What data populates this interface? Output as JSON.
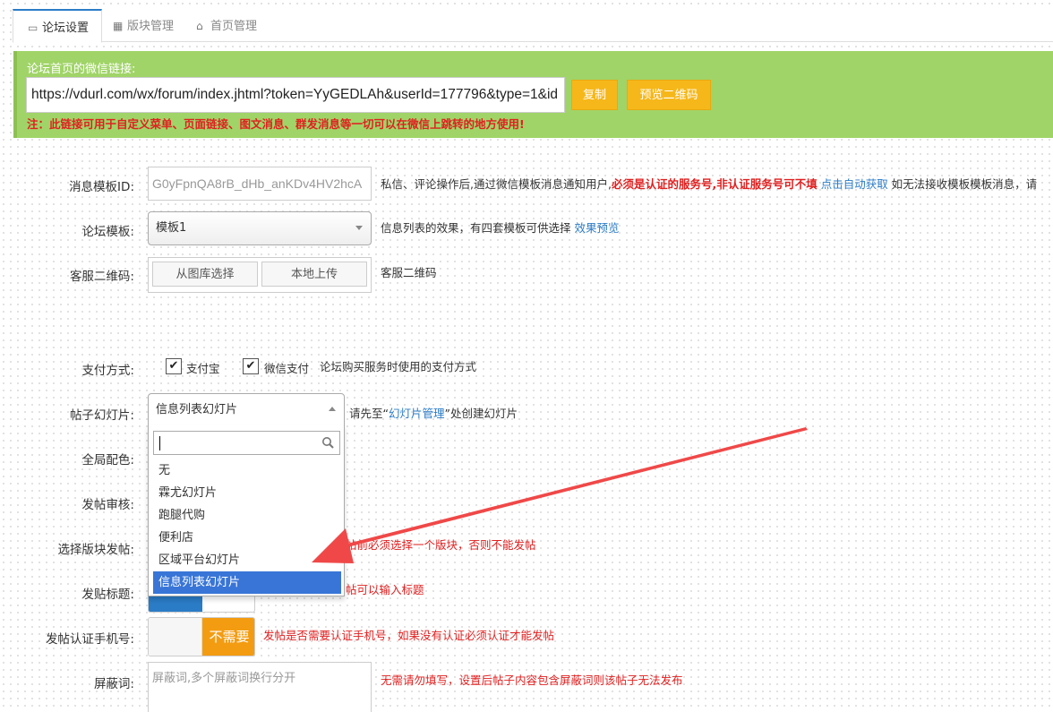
{
  "tabs": [
    {
      "label": "论坛设置",
      "icon": "card-icon",
      "glyph": "▭"
    },
    {
      "label": "版块管理",
      "icon": "grid-icon",
      "glyph": "▦"
    },
    {
      "label": "首页管理",
      "icon": "home-icon",
      "glyph": "⌂"
    }
  ],
  "banner": {
    "title": "论坛首页的微信链接:",
    "url": "https://vdurl.com/wx/forum/index.jhtml?token=YyGEDLAh&userId=177796&type=1&id",
    "copy_label": "复制",
    "preview_label": "预览二维码",
    "note": "注：此链接可用于自定义菜单、页面链接、图文消息、群发消息等一切可以在微信上跳转的地方使用!"
  },
  "form": {
    "msg_template": {
      "label": "消息模板ID:",
      "value": "G0yFpnQA8rB_dHb_anKDv4HV2hcA",
      "help_text": "私信、评论操作后,通过微信模板消息通知用户,",
      "help_bold": "必须是认证的服务号,非认证服务号可不填",
      "help_link": "点击自动获取",
      "help_tail": " 如无法接收模板模板消息，请"
    },
    "forum_template": {
      "label": "论坛模板:",
      "value": "模板1",
      "help_text": "信息列表的效果，有四套模板可供选择 ",
      "help_link": "效果预览"
    },
    "service_qr": {
      "label": "客服二维码:",
      "btn_gallery": "从图库选择",
      "btn_local": "本地上传",
      "help_text": "客服二维码"
    },
    "payment": {
      "label": "支付方式:",
      "options": [
        {
          "label": "支付宝",
          "checked": true
        },
        {
          "label": "微信支付",
          "checked": true
        }
      ],
      "help_text": "论坛购买服务时使用的支付方式"
    },
    "slideshow": {
      "label": "帖子幻灯片:",
      "value": "信息列表幻灯片",
      "help_prefix": "请先至“",
      "help_link": "幻灯片管理",
      "help_suffix": "”处创建幻灯片",
      "search_placeholder": "",
      "options": [
        "无",
        "霖尤幻灯片",
        "跑腿代购",
        "便利店",
        "区域平台幻灯片",
        "信息列表幻灯片"
      ],
      "selected_index": 5
    },
    "color": {
      "label": "全局配色:"
    },
    "audit": {
      "label": "发帖审核:"
    },
    "choose_board": {
      "label": "选择版块发帖:",
      "help_text": "帖前必须选择一个版块，否则不能发帖"
    },
    "post_title": {
      "label": "发贴标题:",
      "help_text": "帖可以输入标题"
    },
    "phone_verify": {
      "label": "发帖认证手机号:",
      "toggle_text": "不需要",
      "help_text": "发帖是否需要认证手机号，如果没有认证必须认证才能发帖"
    },
    "blocked_words": {
      "label": "屏蔽词:",
      "placeholder": "屏蔽词,多个屏蔽词换行分开",
      "help_text": "无需请勿填写，设置后帖子内容包含屏蔽词则该帖子无法发布"
    }
  },
  "colors": {
    "accent": "#2b7cc6",
    "banner": "#a0d468",
    "button": "#f6b71a",
    "warning": "#e02020",
    "toggle_off": "#f39c12",
    "arrow": "#f04848"
  }
}
